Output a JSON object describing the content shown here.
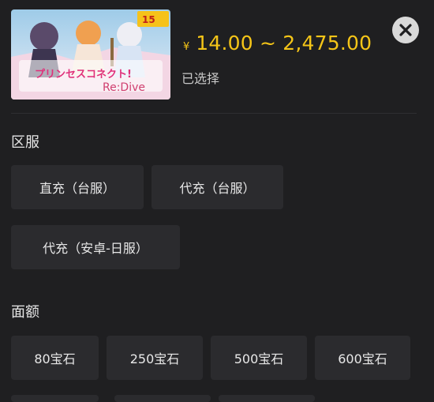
{
  "product": {
    "image_alt": "プリンセスコネクト! Re:Dive",
    "badge_text": "15",
    "logo_title": "プリンセスコネクト!",
    "logo_sub": "Re:Dive",
    "price_symbol": "¥",
    "price_range": "14.00 ~ 2,475.00",
    "selected_label": "已选择"
  },
  "server_section": {
    "title": "区服",
    "options": [
      "直充（台服）",
      "代充（台服）",
      "代充（安卓-日服）"
    ]
  },
  "amount_section": {
    "title": "面额",
    "options": [
      "80宝石",
      "250宝石",
      "500宝石",
      "600宝石"
    ]
  },
  "icons": {
    "close": "close-icon"
  },
  "colors": {
    "background": "#1f1f21",
    "option_bg": "#2b2b2e",
    "price": "#f5c518",
    "close_bg": "#d9d9d9"
  }
}
